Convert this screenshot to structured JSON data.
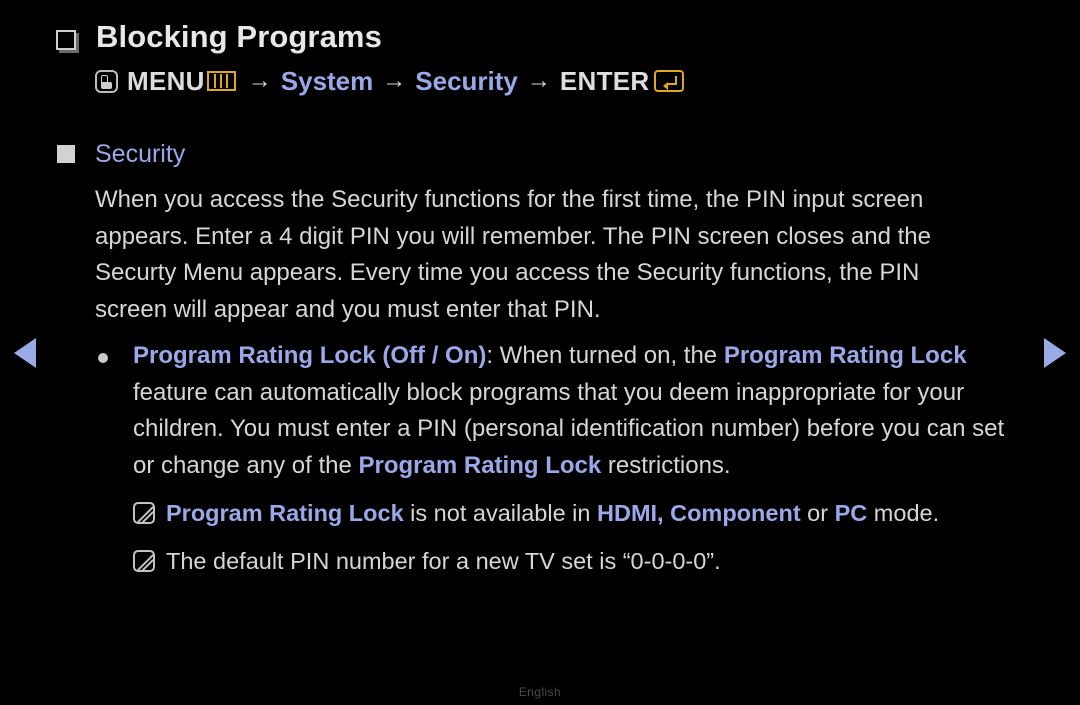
{
  "page": {
    "title": "Blocking Programs",
    "language_footer": "English"
  },
  "breadcrumb": {
    "menu_label": "MENU",
    "sep": "→",
    "system_label": "System",
    "security_label": "Security",
    "enter_label": "ENTER",
    "icons": {
      "hand": "menu-hand-icon",
      "menu_bars": "menu-bars-icon",
      "enter": "enter-key-icon"
    }
  },
  "section": {
    "heading": "Security",
    "paragraph": "When you access the Security functions for the first time, the PIN input screen appears. Enter a 4 digit PIN you will remember. The PIN screen closes and the Securty Menu appears. Every time you access the Security functions, the PIN screen will appear and you must enter that PIN."
  },
  "bullet": {
    "lead_highlight": "Program Rating Lock (Off / On)",
    "after_lead": ": When turned on, the ",
    "highlight_2": "Program Rating Lock",
    "mid_text": " feature can automatically block programs that you deem inappropriate for your children. You must enter a PIN (personal identification number) before you can set or change any of the ",
    "highlight_3": "Program Rating Lock",
    "tail_text": " restrictions."
  },
  "notes": [
    {
      "icon": "note-icon",
      "highlight_1": "Program Rating Lock",
      "text_1": " is not available in ",
      "highlight_2": "HDMI, Component",
      "text_2": " or ",
      "highlight_3": "PC",
      "text_3": " mode."
    },
    {
      "icon": "note-icon",
      "text_full": "The default PIN number for a new TV set is “0-0-0-0”."
    }
  ],
  "navigation": {
    "prev_label": "◀",
    "next_label": "▶"
  },
  "colors": {
    "background": "#000000",
    "body_text": "#d6d6d6",
    "accent_blue": "#9aa8e8",
    "accent_gold": "#e0a81e",
    "nav_arrow": "#9aaae4",
    "footer_text": "#4a4a4a"
  }
}
